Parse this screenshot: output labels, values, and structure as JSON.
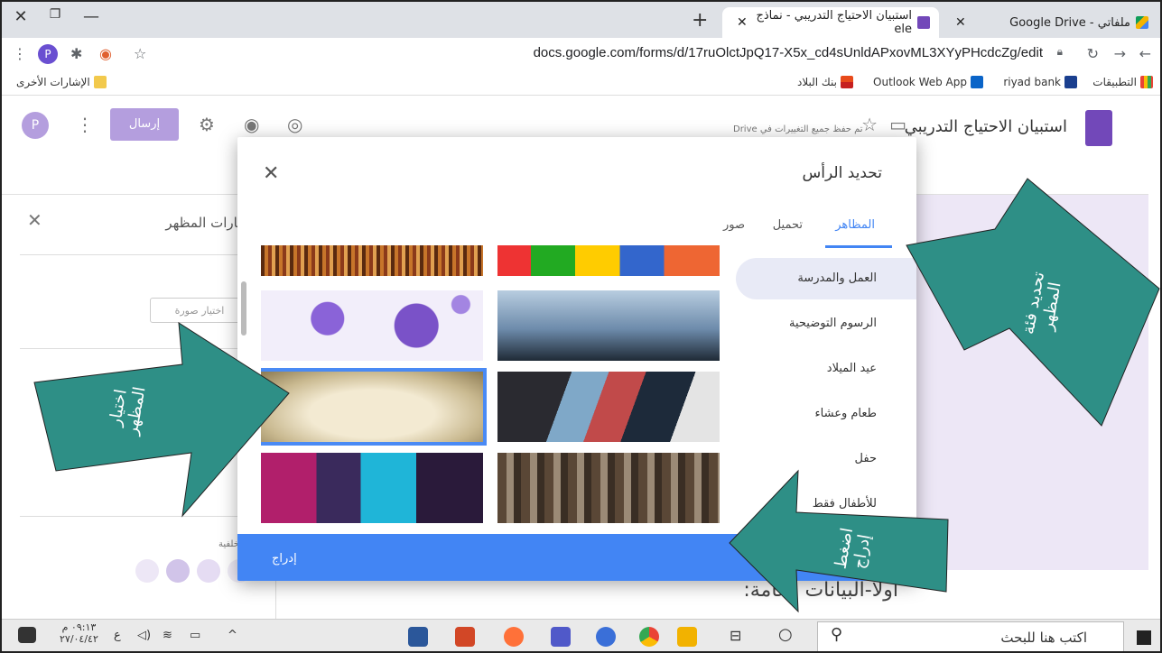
{
  "browser": {
    "tabs": [
      {
        "title": "ملفاتي - Google Drive",
        "active": false
      },
      {
        "title": "استبيان الاحتياج التدريبي - نماذج ele",
        "active": true
      }
    ],
    "url": "docs.google.com/forms/d/17ruOlctJpQ17-X5x_cd4sUnldAPxovML3XYyPHcdcZg/edit",
    "bookmarks": {
      "apps": "التطبيقات",
      "riyad": "riyad bank",
      "outlook": "Outlook Web App",
      "albilad": "بنك البلاد",
      "other": "الإشارات الأخرى"
    },
    "profile_initial": "P"
  },
  "form": {
    "title": "استبيان الاحتياج التدريبي",
    "saved_note": "تم حفظ جميع التغييرات في Drive",
    "send_label": "إرسال",
    "avatar_initial": "P",
    "question_heading": "أولا-البيانات العامة:"
  },
  "theme_panel": {
    "title": "خيارات المظهر",
    "choose_image": "اختيار صورة",
    "background_label": "الخلفية",
    "swatches": [
      "#d1c4e9",
      "#ede7f6",
      "#e8e0f5",
      "#f3f0f9"
    ]
  },
  "dialog": {
    "title": "تحديد الرأس",
    "tabs": [
      {
        "label": "المظاهر",
        "active": true
      },
      {
        "label": "تحميل",
        "active": false
      },
      {
        "label": "صور",
        "active": false
      }
    ],
    "categories": [
      {
        "label": "العمل والمدرسة",
        "selected": true
      },
      {
        "label": "الرسوم التوضيحية",
        "selected": false
      },
      {
        "label": "عيد الميلاد",
        "selected": false
      },
      {
        "label": "طعام وعشاء",
        "selected": false
      },
      {
        "label": "حفل",
        "selected": false
      },
      {
        "label": "للأطفال فقط",
        "selected": false
      }
    ],
    "insert_label": "إدراج"
  },
  "annotations": {
    "choose_theme": "اختيار المظهر",
    "select_category": "تحديد فئة المظهر",
    "press_insert": "اضغط إدراج"
  },
  "taskbar": {
    "search_placeholder": "اكتب هنا للبحث",
    "time": "٠٩:١٣ م",
    "date": "٢٧/٠٤/٤٢",
    "lang": "ع"
  }
}
